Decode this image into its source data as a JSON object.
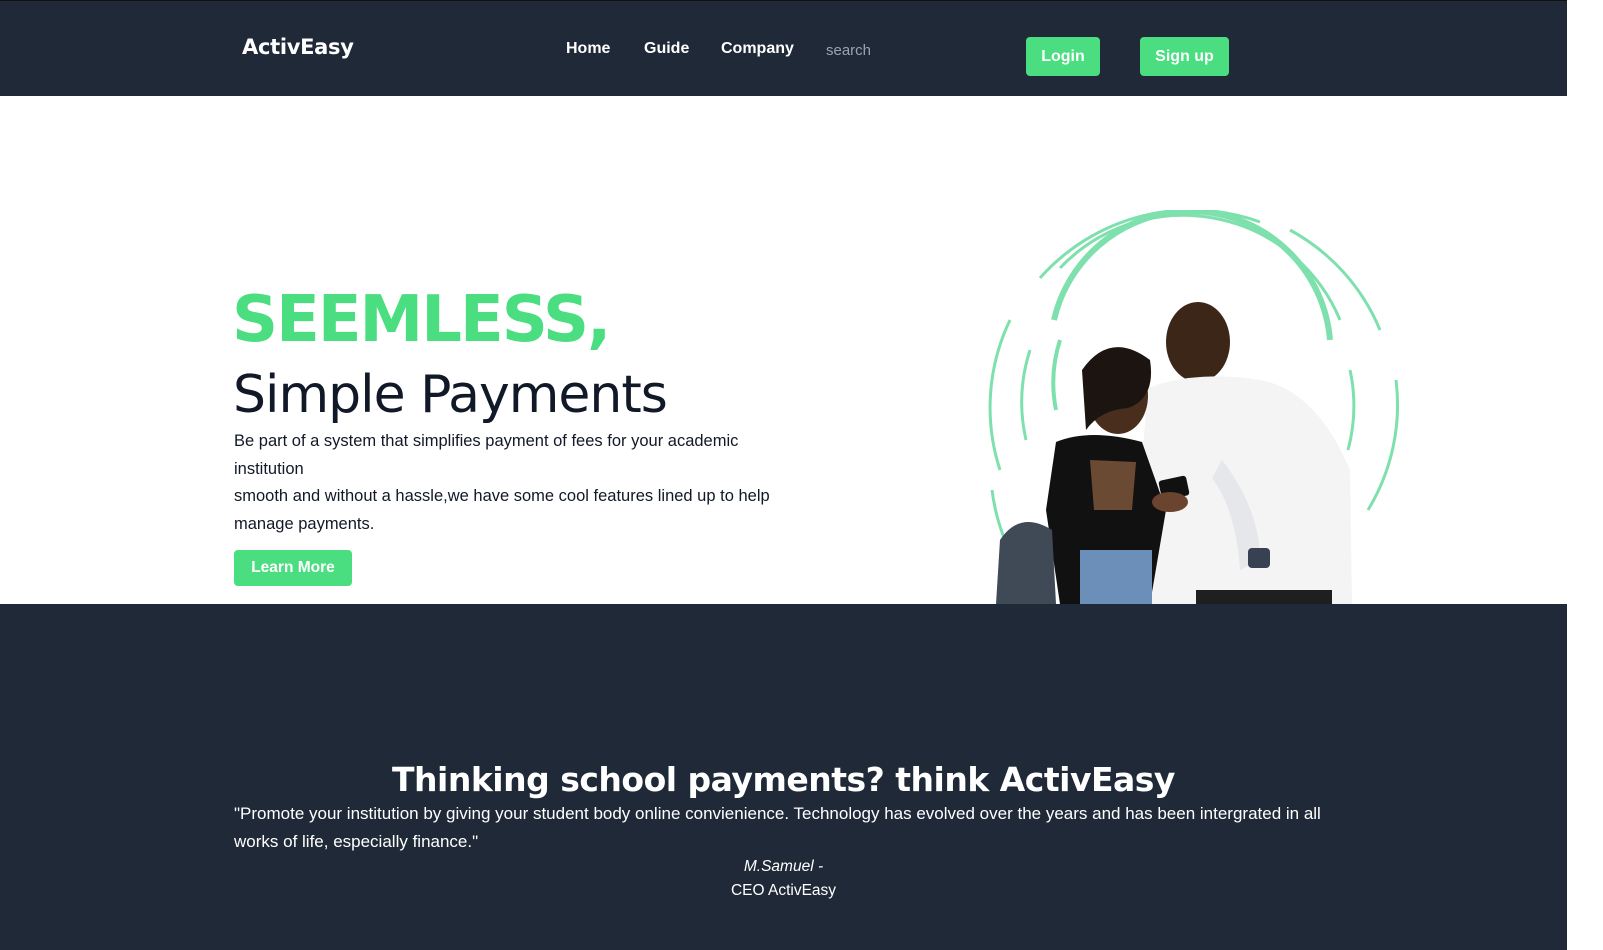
{
  "nav": {
    "brand": "ActivEasy",
    "links": [
      "Home",
      "Guide",
      "Company"
    ],
    "search_placeholder": "search",
    "login_label": "Login",
    "signup_label": "Sign up"
  },
  "hero": {
    "headline_accent": "SEEMLESS,",
    "headline_main": "Simple Payments",
    "paragraph_line1": "Be part of a system that simplifies payment of fees for your academic institution",
    "paragraph_line2": "smooth and without a hassle,we have some cool features lined up to help manage payments.",
    "cta_label": "Learn More"
  },
  "testimonial": {
    "title": "Thinking school payments? think ActivEasy",
    "quote": "\"Promote your institution by giving your student body online convienience. Technology has evolved over the years and has been intergrated in all works of life, especially finance.\"",
    "author": "M.Samuel -",
    "role": "CEO ActivEasy"
  },
  "colors": {
    "accent": "#4ade80",
    "dark_bg": "#1f2937",
    "text_dark": "#111827"
  },
  "icons": {
    "hero_image": "people-with-phone-illustration"
  }
}
